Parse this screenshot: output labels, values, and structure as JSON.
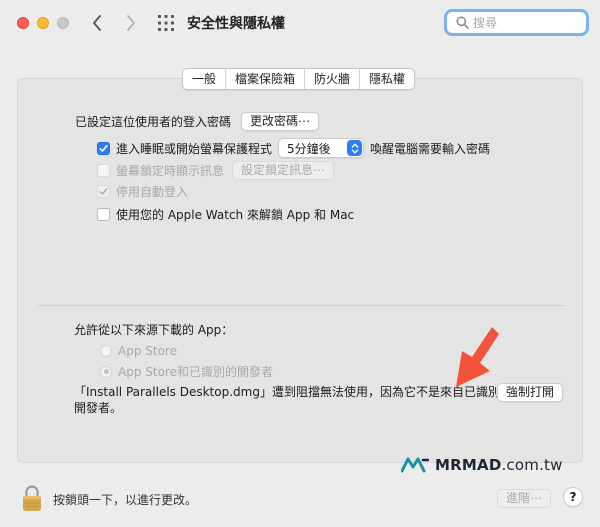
{
  "window": {
    "title": "安全性與隱私權"
  },
  "search": {
    "placeholder": "搜尋"
  },
  "tabs": [
    {
      "label": "一般",
      "active": true
    },
    {
      "label": "檔案保險箱",
      "active": false
    },
    {
      "label": "防火牆",
      "active": false
    },
    {
      "label": "隱私權",
      "active": false
    }
  ],
  "general": {
    "login_password_label": "已設定這位使用者的登入密碼",
    "change_password_button": "更改密碼⋯",
    "require_password": {
      "checked": true,
      "label_before": "進入睡眠或開始螢幕保護程式",
      "selected_delay": "5分鐘後",
      "label_after": "喚醒電腦需要輸入密碼"
    },
    "show_message": {
      "checked": false,
      "enabled": false,
      "label": "螢幕鎖定時顯示訊息",
      "button": "設定鎖定訊息⋯"
    },
    "disable_auto_login": {
      "checked": true,
      "enabled": false,
      "label": "停用自動登入"
    },
    "apple_watch_unlock": {
      "checked": false,
      "enabled": true,
      "label": "使用您的 Apple Watch 來解鎖 App 和 Mac"
    }
  },
  "downloads": {
    "heading": "允許從以下來源下載的 App：",
    "options": [
      {
        "label": "App Store",
        "selected": false
      },
      {
        "label": "App Store和已識別的開發者",
        "selected": true
      }
    ],
    "blocked_message": "「Install Parallels Desktop.dmg」遭到阻擋無法使用，因為它不是來自已識別的開發者。",
    "open_anyway_button": "強制打開"
  },
  "watermark": {
    "brand": "MRMAD",
    "suffix": ".com.tw"
  },
  "footer": {
    "lock_text": "按鎖頭一下，以進行更改。",
    "advanced_button": "進階⋯",
    "help_button": "?"
  },
  "colors": {
    "accent": "#2f7cf6",
    "search_focus": "#7db2ee",
    "annotation_arrow": "#f2533a",
    "close": "#fe5f57",
    "minimize": "#febc2e",
    "lock_gold": "#d8a64a",
    "brand_teal": "#1f8fa3"
  }
}
